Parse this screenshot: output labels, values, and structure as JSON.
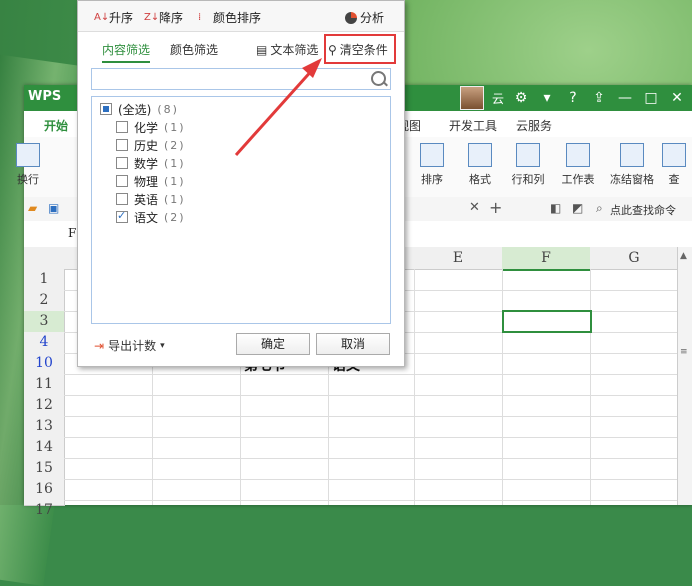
{
  "window": {
    "app_name": "WPS",
    "user_label": "云",
    "minimize": "—",
    "maximize": "□",
    "close": "✕"
  },
  "ribbon": {
    "tabs": [
      "开始",
      "视图",
      "开发工具",
      "云服务"
    ],
    "buttons": [
      "排序",
      "格式",
      "行和列",
      "工作表",
      "冻结窗格",
      "查"
    ],
    "left_label": "换行"
  },
  "toolbar": {
    "tab_close": "✕",
    "tab_add": "+",
    "find": "点此查找命令"
  },
  "formula": {
    "cell_ref": "F"
  },
  "grid": {
    "columns": [
      "E",
      "F",
      "G"
    ],
    "rows": [
      "1",
      "2",
      "3",
      "4",
      "10",
      "11",
      "12",
      "13",
      "14",
      "15",
      "16",
      "17"
    ],
    "cell_text_1": "第七节",
    "cell_text_2": "语文"
  },
  "filter_dropdown": {
    "sort_asc": "升序",
    "sort_desc": "降序",
    "color_sort": "颜色排序",
    "analysis": "分析",
    "tab_content": "内容筛选",
    "tab_color": "颜色筛选",
    "text_filter": "文本筛选",
    "clear_conditions": "清空条件",
    "search_placeholder": "",
    "items": [
      {
        "label": "(全选)",
        "count": "(8)",
        "state": "partial"
      },
      {
        "label": "化学",
        "count": "(1)",
        "state": "unchecked"
      },
      {
        "label": "历史",
        "count": "(2)",
        "state": "unchecked"
      },
      {
        "label": "数学",
        "count": "(1)",
        "state": "unchecked"
      },
      {
        "label": "物理",
        "count": "(1)",
        "state": "unchecked"
      },
      {
        "label": "英语",
        "count": "(1)",
        "state": "unchecked"
      },
      {
        "label": "语文",
        "count": "(2)",
        "state": "checked"
      }
    ],
    "export_count": "导出计数",
    "ok": "确定",
    "cancel": "取消"
  },
  "colors": {
    "accent": "#2f8f3e",
    "highlight_box": "#e23a3a",
    "arrow": "#e23a3a"
  }
}
